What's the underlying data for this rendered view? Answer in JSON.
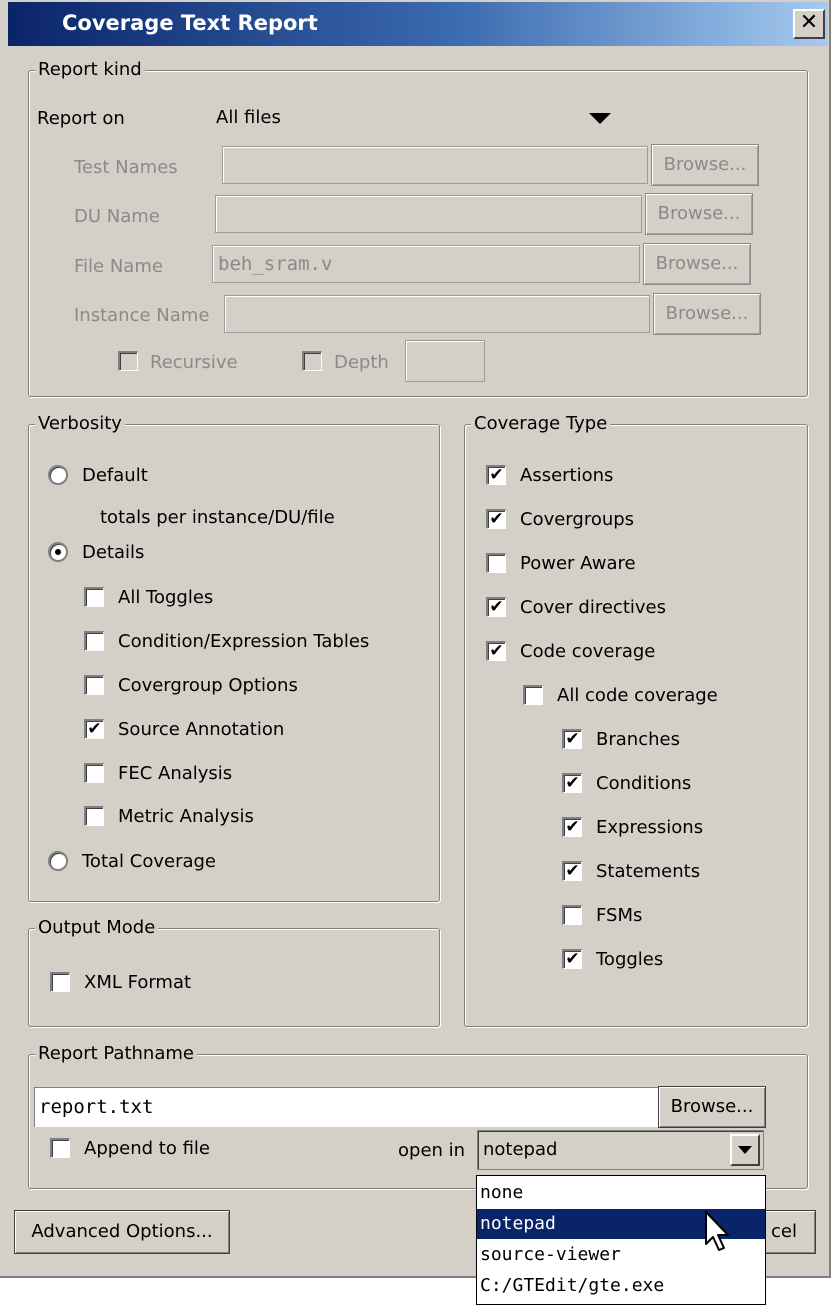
{
  "window": {
    "title": "Coverage Text Report",
    "close_glyph": "✕"
  },
  "report_kind": {
    "title": "Report kind",
    "report_on_label": "Report on",
    "report_on_value": "All files",
    "test_names_label": "Test Names",
    "test_names_value": "",
    "du_name_label": "DU Name",
    "du_name_value": "",
    "file_name_label": "File Name",
    "file_name_value": "beh_sram.v",
    "instance_name_label": "Instance Name",
    "instance_name_value": "",
    "browse_label": "Browse...",
    "recursive_label": "Recursive",
    "depth_label": "Depth",
    "depth_value": ""
  },
  "verbosity": {
    "title": "Verbosity",
    "default_label": "Default",
    "default_note": "totals per instance/DU/file",
    "details_label": "Details",
    "total_coverage_label": "Total Coverage",
    "selected": "Details",
    "options": [
      {
        "label": "All Toggles",
        "checked": false
      },
      {
        "label": "Condition/Expression Tables",
        "checked": false
      },
      {
        "label": "Covergroup Options",
        "checked": false
      },
      {
        "label": "Source Annotation",
        "checked": true
      },
      {
        "label": "FEC Analysis",
        "checked": false
      },
      {
        "label": "Metric Analysis",
        "checked": false
      }
    ]
  },
  "coverage_type": {
    "title": "Coverage Type",
    "items": [
      {
        "label": "Assertions",
        "checked": true
      },
      {
        "label": "Covergroups",
        "checked": true
      },
      {
        "label": "Power Aware",
        "checked": false
      },
      {
        "label": "Cover directives",
        "checked": true
      },
      {
        "label": "Code coverage",
        "checked": true
      },
      {
        "label": "All code coverage",
        "checked": false
      },
      {
        "label": "Branches",
        "checked": true
      },
      {
        "label": "Conditions",
        "checked": true
      },
      {
        "label": "Expressions",
        "checked": true
      },
      {
        "label": "Statements",
        "checked": true
      },
      {
        "label": "FSMs",
        "checked": false
      },
      {
        "label": "Toggles",
        "checked": true
      }
    ]
  },
  "output_mode": {
    "title": "Output Mode",
    "xml_label": "XML Format",
    "xml_checked": false
  },
  "report_pathname": {
    "title": "Report Pathname",
    "path_value": "report.txt",
    "browse_label": "Browse...",
    "append_label": "Append to file",
    "append_checked": false,
    "open_in_label": "open in",
    "open_in_value": "notepad",
    "open_in_options": [
      "none",
      "notepad",
      "source-viewer",
      "C:/GTEdit/gte.exe"
    ],
    "highlighted_option": "notepad"
  },
  "footer": {
    "advanced_label": "Advanced Options...",
    "cancel_partial": "cel"
  },
  "check_glyph": "✔"
}
